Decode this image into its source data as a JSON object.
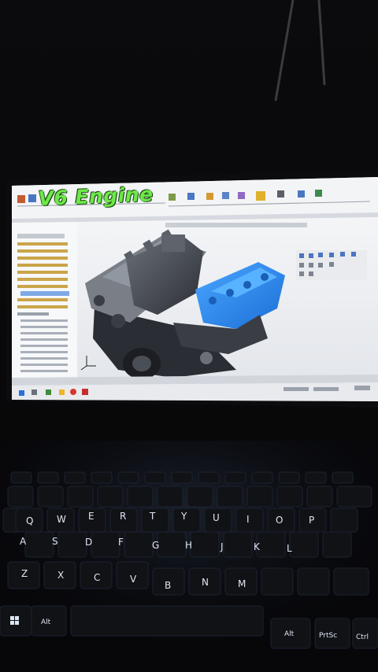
{
  "caption": "V6 Engine",
  "keyboard": {
    "row_qwerty": [
      "Q",
      "W",
      "E",
      "R",
      "T",
      "Y",
      "U",
      "I",
      "O",
      "P"
    ],
    "row_asdf": [
      "A",
      "S",
      "D",
      "F",
      "G",
      "H",
      "J",
      "K",
      "L"
    ],
    "row_zxcv": [
      "Z",
      "X",
      "C",
      "V",
      "B",
      "N",
      "M"
    ],
    "row_bottom": [
      "Alt",
      "PrtSc",
      "Ctrl"
    ]
  }
}
